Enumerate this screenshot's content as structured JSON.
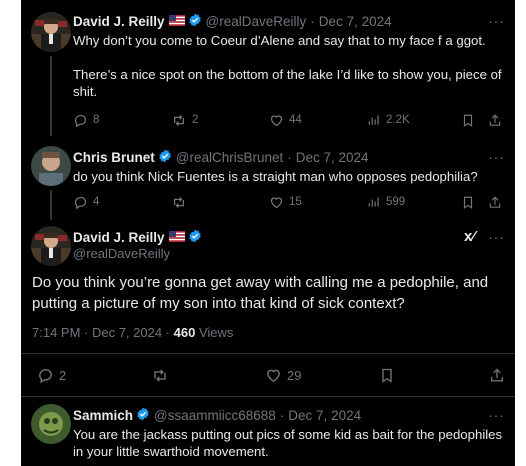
{
  "colors": {
    "background": "#000000",
    "text": "#e7e9ea",
    "muted": "#71767b",
    "verified": "#1d9bf0",
    "divider": "#2f3336"
  },
  "tweet1": {
    "name": "David J. Reilly",
    "handle": "@realDaveReilly",
    "date": "Dec 7, 2024",
    "text_line1": "Why don’t you come to Coeur d’Alene and say that to my face f a ggot.",
    "text_line2": "There’s a nice spot on the bottom of the lake I’d like to show you, piece of",
    "text_line3": "shit.",
    "replies": "8",
    "reposts": "2",
    "likes": "44",
    "views": "2.2K",
    "more": "···"
  },
  "tweet2": {
    "name": "Chris Brunet",
    "handle": "@realChrisBrunet",
    "date": "Dec 7, 2024",
    "text": "do you think Nick Fuentes is a straight man who opposes pedophilia?",
    "replies": "4",
    "reposts": "",
    "likes": "15",
    "views": "599",
    "more": "···"
  },
  "main": {
    "name": "David J. Reilly",
    "handle": "@realDaveReilly",
    "grok": "x⁄",
    "more": "···",
    "text_line1": "Do you think you’re gonna get away with calling me a pedophile, and",
    "text_line2": "putting a picture of my son into that kind of sick context?",
    "time": "7:14 PM · Dec 7, 2024 ·",
    "views_count": "460",
    "views_label": "Views",
    "replies": "2",
    "likes": "29"
  },
  "reply": {
    "name": "Sammich",
    "handle": "@ssaammiicc68688",
    "date": "Dec 7, 2024",
    "text_line1": "You are the jackass putting out pics of some kid as bait for the pedophiles",
    "text_line2": "in your little swarthoid movement.",
    "more": "···"
  },
  "icons": [
    "reply-icon",
    "repost-icon",
    "like-icon",
    "views-icon",
    "bookmark-icon",
    "share-icon",
    "verified-badge-icon",
    "us-flag-icon",
    "grok-icon"
  ]
}
